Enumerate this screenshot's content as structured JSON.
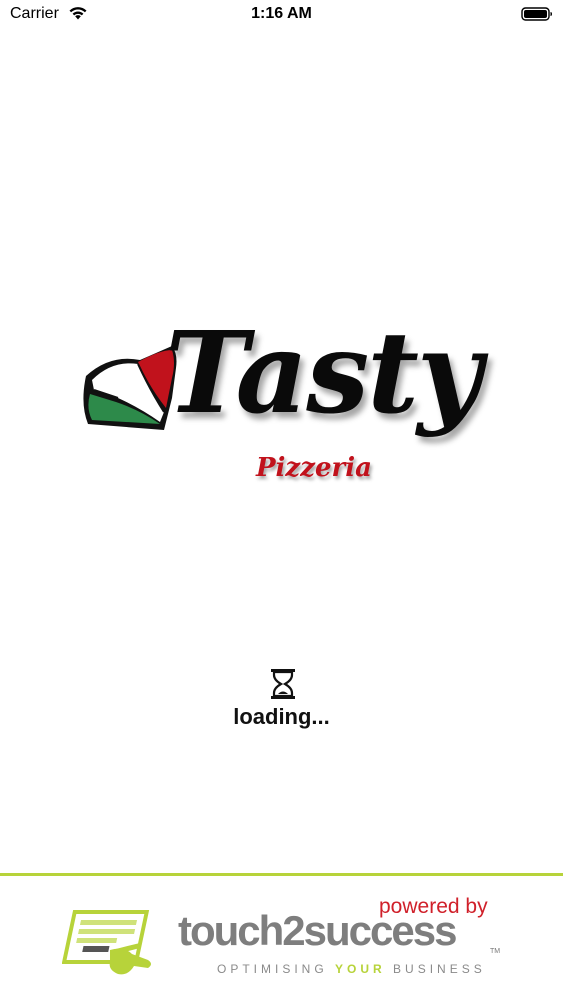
{
  "status_bar": {
    "carrier": "Carrier",
    "time": "1:16 AM",
    "wifi_icon": "wifi-icon",
    "battery_icon": "battery-icon"
  },
  "splash": {
    "brand_name": "Tasty",
    "brand_subtitle": "Pizzeria",
    "logo_icon": "pizza-slice-icon",
    "logo_colors": {
      "red": "#c1121c",
      "white": "#ffffff",
      "green": "#2d8a4a",
      "outline": "#111111"
    },
    "loading_icon": "hourglass-icon",
    "loading_text": "loading..."
  },
  "footer": {
    "powered_by": "powered by",
    "company_name": "touch2success",
    "trademark": "TM",
    "tagline_start": "OPTIMISING",
    "tagline_accent": "YOUR",
    "tagline_end": "BUSINESS",
    "icon": "touchscreen-hand-icon",
    "colors": {
      "accent": "#b7d33a",
      "brand_grey": "#7e7e7e",
      "powered_red": "#d0202a"
    }
  }
}
